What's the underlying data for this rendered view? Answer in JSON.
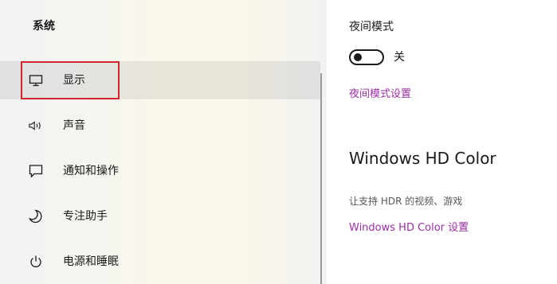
{
  "sidebar": {
    "title": "系统",
    "items": [
      {
        "label": "显示",
        "icon": "monitor-icon",
        "selected": true
      },
      {
        "label": "声音",
        "icon": "speaker-icon"
      },
      {
        "label": "通知和操作",
        "icon": "message-icon"
      },
      {
        "label": "专注助手",
        "icon": "moon-icon"
      },
      {
        "label": "电源和睡眠",
        "icon": "power-icon"
      }
    ]
  },
  "main": {
    "night_mode_title": "夜间模式",
    "night_mode_state": "关",
    "night_mode_settings_link": "夜间模式设置",
    "hd_color_heading": "Windows HD Color",
    "hd_color_description": "让支持 HDR 的视频、游戏",
    "hd_color_settings_link": "Windows HD Color 设置"
  },
  "colors": {
    "link": "#9a2fa3",
    "highlight_border": "#d3262c"
  }
}
